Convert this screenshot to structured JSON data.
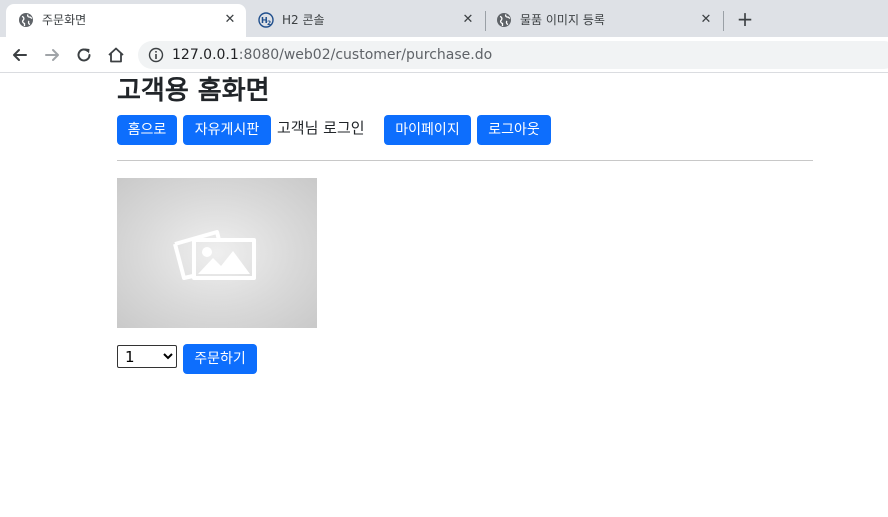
{
  "browser": {
    "tabs": [
      {
        "title": "주문화면",
        "active": true
      },
      {
        "title": "H2 콘솔",
        "active": false
      },
      {
        "title": "물품 이미지 등록",
        "active": false
      }
    ],
    "url_host": "127.0.0.1",
    "url_rest": ":8080/web02/customer/purchase.do"
  },
  "page": {
    "title": "고객용 홈화면",
    "nav": {
      "home": "홈으로",
      "board": "자유게시판",
      "login_status": "고객님 로그인",
      "mypage": "마이페이지",
      "logout": "로그아웃"
    },
    "order": {
      "quantity_selected": "1",
      "submit_label": "주문하기"
    }
  },
  "colors": {
    "primary": "#0d6efd",
    "tabstrip": "#dee1e6"
  }
}
